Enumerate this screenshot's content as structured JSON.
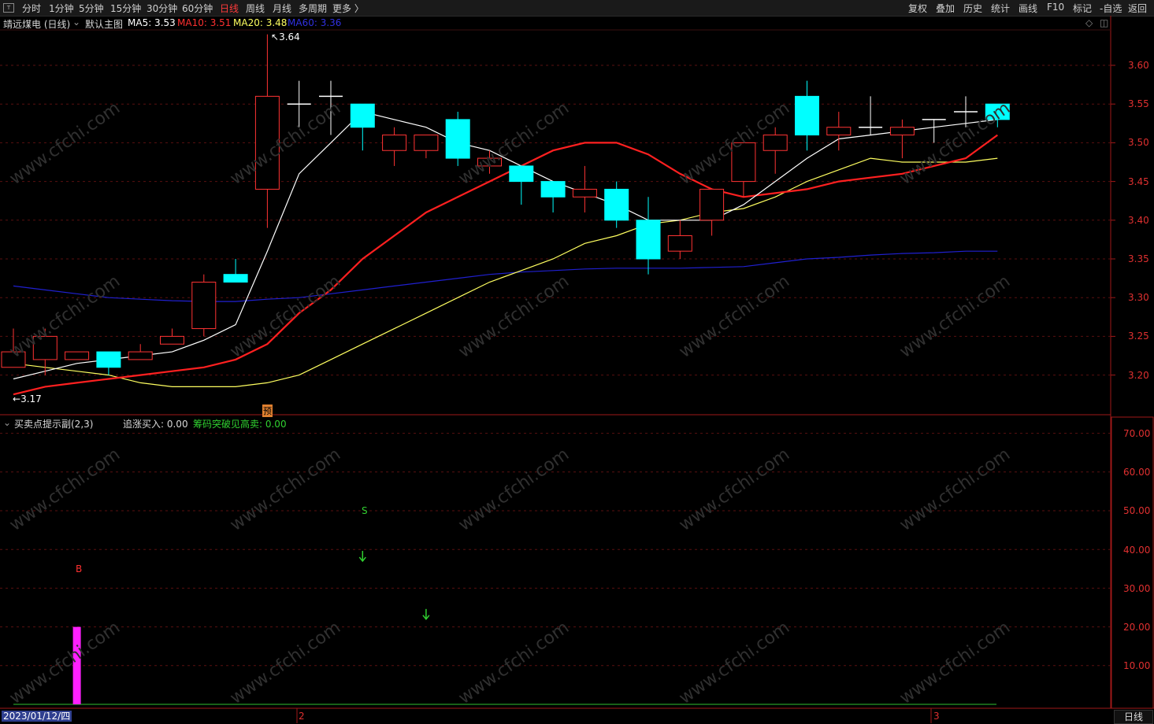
{
  "toolbar": {
    "logo": "T",
    "periods": [
      "分时",
      "1分钟",
      "5分钟",
      "15分钟",
      "30分钟",
      "60分钟",
      "日线",
      "周线",
      "月线",
      "多周期",
      "更多 〉"
    ],
    "active_period": "日线",
    "right_buttons": [
      "复权",
      "叠加",
      "历史",
      "统计",
      "画线",
      "F10",
      "标记",
      "-自选",
      "返回"
    ]
  },
  "main_chart": {
    "stock_name": "靖远煤电 (日线)",
    "indicator_name": "默认主图",
    "ma5_label": "MA5: 3.53",
    "ma10_label": "MA10: 3.51",
    "ma20_label": "MA20: 3.48",
    "ma60_label": "MA60: 3.36",
    "high_label": "3.64",
    "low_label": "3.17",
    "pre_marker": "预",
    "y_ticks": [
      "3.60",
      "3.55",
      "3.50",
      "3.45",
      "3.40",
      "3.35",
      "3.30",
      "3.25",
      "3.20"
    ],
    "colors": {
      "up": "#ff3333",
      "down": "#00ffff",
      "ma5": "#ffffff",
      "ma10": "#ff2020",
      "ma20": "#ffff60",
      "ma60": "#2020d0"
    }
  },
  "sub_chart": {
    "indicator_name": "买卖点提示副(2,3)",
    "chase_label": "追涨买入: 0.00",
    "chip_label": "筹码突破见高卖: 0.00",
    "b_marker": "B",
    "s_marker": "S",
    "y_ticks": [
      "70.00",
      "60.00",
      "50.00",
      "40.00",
      "30.00",
      "20.00",
      "10.00"
    ]
  },
  "footer": {
    "date": "2023/01/12/四",
    "month_2": "2",
    "month_3": "3",
    "period_button": "日线"
  },
  "watermark_text": "www.cfchi.com",
  "chart_data": {
    "type": "candlestick",
    "ylim": [
      3.15,
      3.65
    ],
    "candles": [
      {
        "o": 3.21,
        "c": 3.23,
        "h": 3.26,
        "l": 3.21
      },
      {
        "o": 3.22,
        "c": 3.25,
        "h": 3.26,
        "l": 3.2
      },
      {
        "o": 3.22,
        "c": 3.23,
        "h": 3.23,
        "l": 3.22
      },
      {
        "o": 3.23,
        "c": 3.21,
        "h": 3.23,
        "l": 3.2
      },
      {
        "o": 3.22,
        "c": 3.23,
        "h": 3.24,
        "l": 3.22
      },
      {
        "o": 3.24,
        "c": 3.25,
        "h": 3.26,
        "l": 3.24
      },
      {
        "o": 3.26,
        "c": 3.32,
        "h": 3.33,
        "l": 3.25
      },
      {
        "o": 3.33,
        "c": 3.32,
        "h": 3.35,
        "l": 3.32
      },
      {
        "o": 3.44,
        "c": 3.56,
        "h": 3.64,
        "l": 3.39
      },
      {
        "o": 3.55,
        "c": 3.55,
        "h": 3.58,
        "l": 3.52
      },
      {
        "o": 3.56,
        "c": 3.56,
        "h": 3.58,
        "l": 3.51
      },
      {
        "o": 3.55,
        "c": 3.52,
        "h": 3.55,
        "l": 3.49
      },
      {
        "o": 3.49,
        "c": 3.51,
        "h": 3.52,
        "l": 3.47
      },
      {
        "o": 3.49,
        "c": 3.51,
        "h": 3.51,
        "l": 3.48
      },
      {
        "o": 3.53,
        "c": 3.48,
        "h": 3.54,
        "l": 3.47
      },
      {
        "o": 3.47,
        "c": 3.48,
        "h": 3.49,
        "l": 3.46
      },
      {
        "o": 3.47,
        "c": 3.45,
        "h": 3.47,
        "l": 3.42
      },
      {
        "o": 3.45,
        "c": 3.43,
        "h": 3.45,
        "l": 3.41
      },
      {
        "o": 3.43,
        "c": 3.44,
        "h": 3.47,
        "l": 3.41
      },
      {
        "o": 3.44,
        "c": 3.4,
        "h": 3.45,
        "l": 3.39
      },
      {
        "o": 3.4,
        "c": 3.35,
        "h": 3.43,
        "l": 3.33
      },
      {
        "o": 3.36,
        "c": 3.38,
        "h": 3.4,
        "l": 3.35
      },
      {
        "o": 3.4,
        "c": 3.44,
        "h": 3.44,
        "l": 3.38
      },
      {
        "o": 3.45,
        "c": 3.5,
        "h": 3.5,
        "l": 3.43
      },
      {
        "o": 3.49,
        "c": 3.51,
        "h": 3.52,
        "l": 3.46
      },
      {
        "o": 3.56,
        "c": 3.51,
        "h": 3.58,
        "l": 3.49
      },
      {
        "o": 3.51,
        "c": 3.52,
        "h": 3.54,
        "l": 3.49
      },
      {
        "o": 3.52,
        "c": 3.52,
        "h": 3.56,
        "l": 3.51
      },
      {
        "o": 3.51,
        "c": 3.52,
        "h": 3.53,
        "l": 3.48
      },
      {
        "o": 3.53,
        "c": 3.53,
        "h": 3.53,
        "l": 3.5
      },
      {
        "o": 3.54,
        "c": 3.54,
        "h": 3.56,
        "l": 3.52
      },
      {
        "o": 3.55,
        "c": 3.53,
        "h": 3.55,
        "l": 3.52
      }
    ],
    "ma5": [
      3.195,
      3.205,
      3.215,
      3.22,
      3.225,
      3.23,
      3.245,
      3.265,
      3.36,
      3.46,
      3.5,
      3.54,
      3.53,
      3.52,
      3.5,
      3.49,
      3.47,
      3.45,
      3.435,
      3.42,
      3.4,
      3.4,
      3.4,
      3.42,
      3.45,
      3.48,
      3.505,
      3.51,
      3.515,
      3.52,
      3.525,
      3.53
    ],
    "ma10": [
      3.175,
      3.185,
      3.19,
      3.195,
      3.2,
      3.205,
      3.21,
      3.22,
      3.24,
      3.28,
      3.31,
      3.35,
      3.38,
      3.41,
      3.43,
      3.45,
      3.47,
      3.49,
      3.5,
      3.5,
      3.485,
      3.46,
      3.44,
      3.43,
      3.435,
      3.44,
      3.45,
      3.455,
      3.46,
      3.47,
      3.48,
      3.51
    ],
    "ma20": [
      3.215,
      3.21,
      3.205,
      3.2,
      3.19,
      3.185,
      3.185,
      3.185,
      3.19,
      3.2,
      3.22,
      3.24,
      3.26,
      3.28,
      3.3,
      3.32,
      3.335,
      3.35,
      3.37,
      3.38,
      3.395,
      3.4,
      3.41,
      3.415,
      3.43,
      3.45,
      3.465,
      3.48,
      3.475,
      3.475,
      3.475,
      3.48
    ],
    "ma60": [
      3.315,
      3.31,
      3.305,
      3.3,
      3.298,
      3.296,
      3.295,
      3.295,
      3.298,
      3.3,
      3.305,
      3.31,
      3.315,
      3.32,
      3.325,
      3.33,
      3.333,
      3.335,
      3.337,
      3.338,
      3.338,
      3.338,
      3.339,
      3.34,
      3.345,
      3.35,
      3.352,
      3.355,
      3.357,
      3.358,
      3.36,
      3.36
    ],
    "sub_ylim": [
      0,
      75
    ],
    "sub_bar": {
      "index": 2,
      "value": 20
    },
    "sub_arrows": [
      {
        "index": 11,
        "value": 38
      },
      {
        "index": 13,
        "value": 23
      }
    ]
  }
}
